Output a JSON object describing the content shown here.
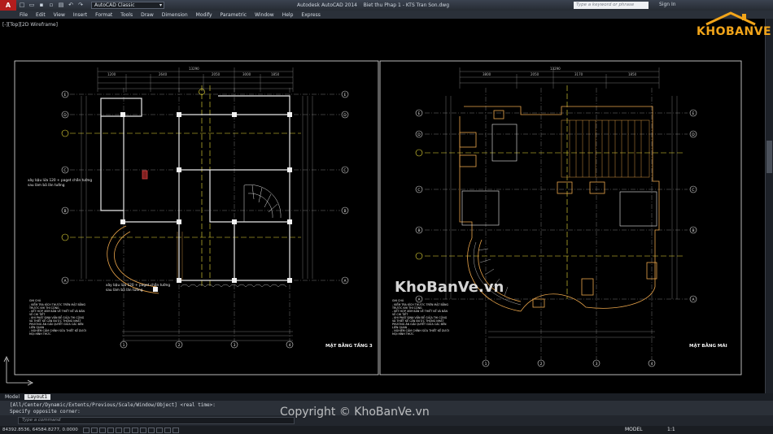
{
  "titlebar": {
    "app_letter": "A",
    "workspace": "AutoCAD Classic",
    "app_name": "Autodesk AutoCAD 2014",
    "file_name": "Biet thu Phap 1 - KTS Tran Son.dwg",
    "search_placeholder": "Type a keyword or phrase",
    "sign_in": "Sign In"
  },
  "menu": [
    "File",
    "Edit",
    "View",
    "Insert",
    "Format",
    "Tools",
    "Draw",
    "Dimension",
    "Modify",
    "Parametric",
    "Window",
    "Help",
    "Express"
  ],
  "viewport_label": "[-][Top][2D Wireframe]",
  "drawing": {
    "left_sheet": {
      "title": "MẶT BẰNG TẦNG 3",
      "note_upper_1": "xây bậu lửa 120 + paget chắn tường",
      "note_upper_2": "sau làm bả lăn tường",
      "note_lower_1": "xây bậu lửa 120 + paget chắn tường",
      "note_lower_2": "sau làm bả lăn tường",
      "ghi_chu_title": "GHI CHÚ",
      "ghi_chu_lines": [
        "- KIỂM TRA KÍCH THƯỚC TRÊN MẶT BẰNG",
        "  TRƯỚC KHI THI CÔNG",
        "- KẾT HỢP XEM BẢN VẼ THIẾT KẾ VÀ BẢN",
        "  VẼ CHI TIẾT",
        "- KHI PHÁT SINH VẤN ĐỀ GIỮA THI CÔNG",
        "  VÀ THIẾT KẾ CẦN ĐƯỢC THỐNG NHẤT",
        "  PHƯƠNG ÁN GIẢI QUYẾT GIỮA CÁC BÊN",
        "  LIÊN QUAN",
        "- NGHIÊM CẤM CHỈNH SỬA THIẾT KẾ DƯỚI",
        "  MỌI HÌNH THỨC"
      ],
      "col_axes": [
        "1",
        "2",
        "3",
        "4"
      ],
      "row_axes": [
        "E",
        "D",
        "C",
        "B",
        "A"
      ],
      "dims_top": [
        "13290",
        "1200",
        "2640",
        "2050",
        "3000",
        "1850"
      ]
    },
    "right_sheet": {
      "title": "MẶT BẰNG MÁI",
      "ghi_chu_title": "GHI CHÚ",
      "ghi_chu_lines": [
        "- KIỂM TRA KÍCH THƯỚC TRÊN MẶT BẰNG",
        "  TRƯỚC KHI THI CÔNG",
        "- KẾT HỢP XEM BẢN VẼ THIẾT KẾ VÀ BẢN",
        "  VẼ CHI TIẾT",
        "- KHI PHÁT SINH VẤN ĐỀ GIỮA THI CÔNG",
        "  VÀ THIẾT KẾ CẦN ĐƯỢC THỐNG NHẤT",
        "  PHƯƠNG ÁN GIẢI QUYẾT GIỮA CÁC BÊN",
        "  LIÊN QUAN",
        "- NGHIÊM CẤM CHỈNH SỬA THIẾT KẾ DƯỚI",
        "  MỌI HÌNH THỨC"
      ],
      "col_axes": [
        "1",
        "2",
        "3",
        "4"
      ],
      "row_axes": [
        "E",
        "D",
        "C",
        "B",
        "A"
      ],
      "dims_top": [
        "13290",
        "3800",
        "2050",
        "3170",
        "1850"
      ]
    }
  },
  "tabs": [
    "Model",
    "Layout1"
  ],
  "command": {
    "history_1": "[All/Center/Dynamic/Extents/Previous/Scale/Window/Object] <real time>:",
    "history_2": "Specify opposite corner:",
    "input_placeholder": "Type a command"
  },
  "status": {
    "coords": "84392.8536, 64584.8277, 0.0000",
    "model": "MODEL",
    "scale": "1:1"
  },
  "brand": {
    "logo": "KHOBANVE",
    "watermark_center": "KhoBanVe.vn",
    "watermark_bottom": "Copyright © KhoBanVe.vn"
  },
  "colors": {
    "accent_red": "#b31d1d",
    "logo_orange": "#f2a51a",
    "axis_yellow": "#f0e23a",
    "wall_white": "#e8e8e8",
    "wood_orange": "#e9a44a",
    "dim_gray": "#9a9a9a"
  }
}
